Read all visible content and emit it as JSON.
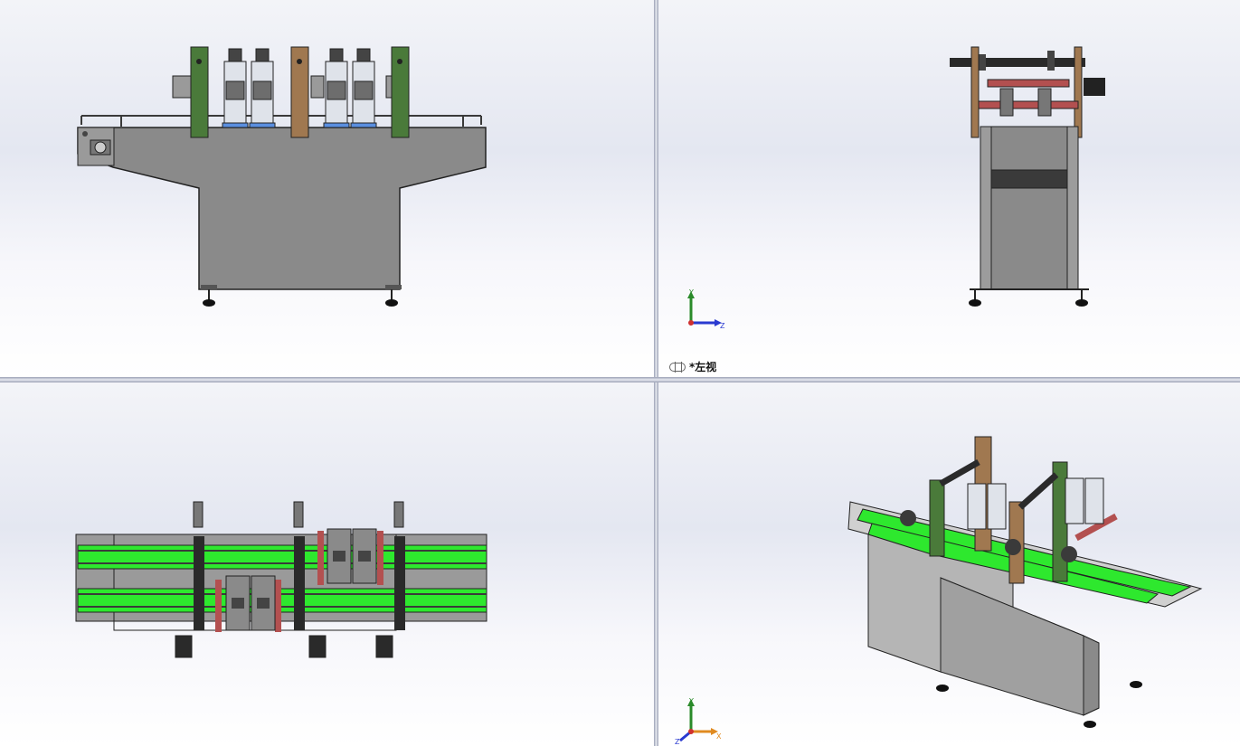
{
  "viewports": {
    "top_left": {
      "name": ""
    },
    "top_right": {
      "name": "*左视",
      "triad": {
        "y": "Y",
        "z": "Z"
      }
    },
    "bottom_left": {
      "name": ""
    },
    "bottom_right": {
      "triad": {
        "y": "Y",
        "z": "Z",
        "x": "X"
      }
    }
  },
  "colors": {
    "frame_gray": "#8a8a8a",
    "conveyor_green": "#2ee82e",
    "upright_green": "#4a7a3a",
    "upright_brown": "#a07850",
    "roller_red": "#b35050",
    "rail_gray": "#5a5a5a"
  }
}
